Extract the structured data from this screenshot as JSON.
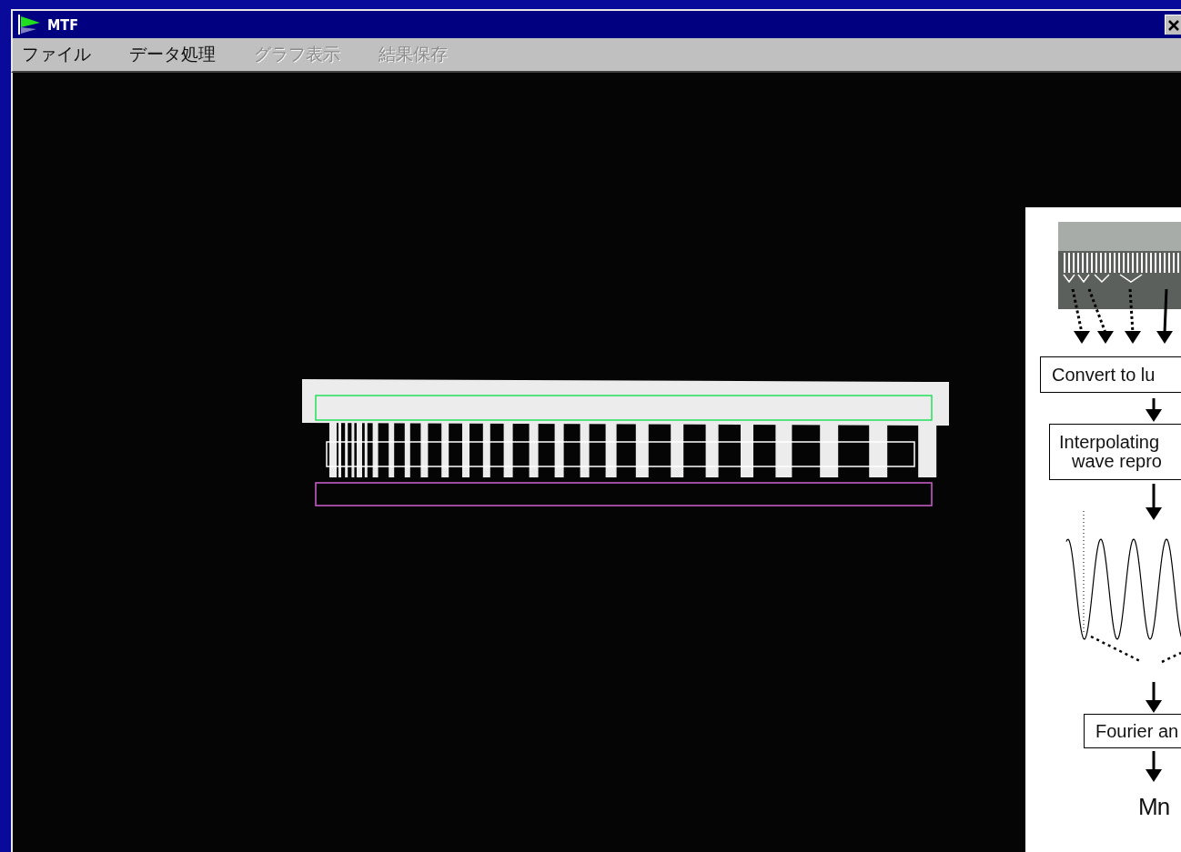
{
  "window": {
    "title": "MTF"
  },
  "menu": [
    {
      "label": "ファイル",
      "disabled": false
    },
    {
      "label": "データ処理",
      "disabled": false
    },
    {
      "label": "グラフ表示",
      "disabled": true
    },
    {
      "label": "結果保存",
      "disabled": true
    }
  ],
  "diagram": {
    "convert_box": "Convert to lu",
    "interpolate_box": [
      "Interpolating",
      "wave repro"
    ],
    "fourier_box": "Fourier an",
    "result_label": "Mn"
  }
}
